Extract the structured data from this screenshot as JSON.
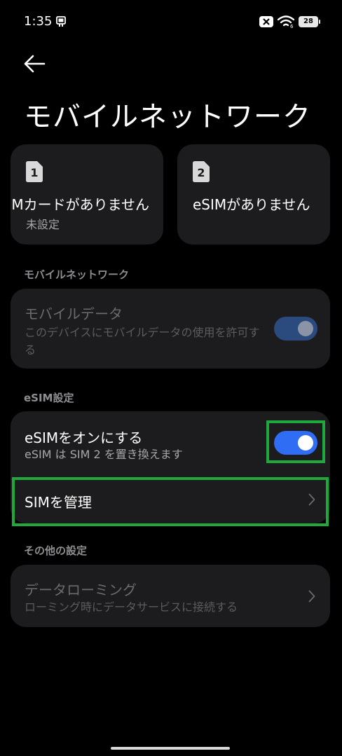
{
  "status_bar": {
    "time": "1:35",
    "battery": "28",
    "icons": [
      "notification-icon",
      "sim-error-icon",
      "wifi-icon",
      "battery-icon"
    ]
  },
  "header": {
    "back_icon": "back-arrow-icon",
    "title": "モバイルネットワーク"
  },
  "sim_cards": [
    {
      "badge": "1",
      "name": "SIMカードがありません",
      "status": "未設定"
    },
    {
      "badge": "2",
      "name": "eSIMがありません",
      "status": ""
    }
  ],
  "sections": {
    "mobile_network": {
      "header": "モバイルネットワーク",
      "mobile_data": {
        "title": "モバイルデータ",
        "subtitle": "このデバイスにモバイルデータの使用を許可する",
        "toggle_on": true,
        "enabled": false
      }
    },
    "esim": {
      "header": "eSIM設定",
      "esim_toggle": {
        "title": "eSIMをオンにする",
        "subtitle": "eSIM は SIM 2 を置き換えます",
        "toggle_on": true
      },
      "manage_sim": {
        "title": "SIMを管理"
      }
    },
    "other": {
      "header": "その他の設定",
      "data_roaming": {
        "title": "データローミング",
        "subtitle": "ローミング時にデータサービスに接続する",
        "enabled": false
      }
    }
  },
  "colors": {
    "background": "#000000",
    "card": "#1c1c1e",
    "accent": "#2f6df5",
    "accent_disabled": "#2b4a7e",
    "highlight": "#1fa83b",
    "secondary_text": "#a7a7ab",
    "section_header": "#8d8d92"
  }
}
